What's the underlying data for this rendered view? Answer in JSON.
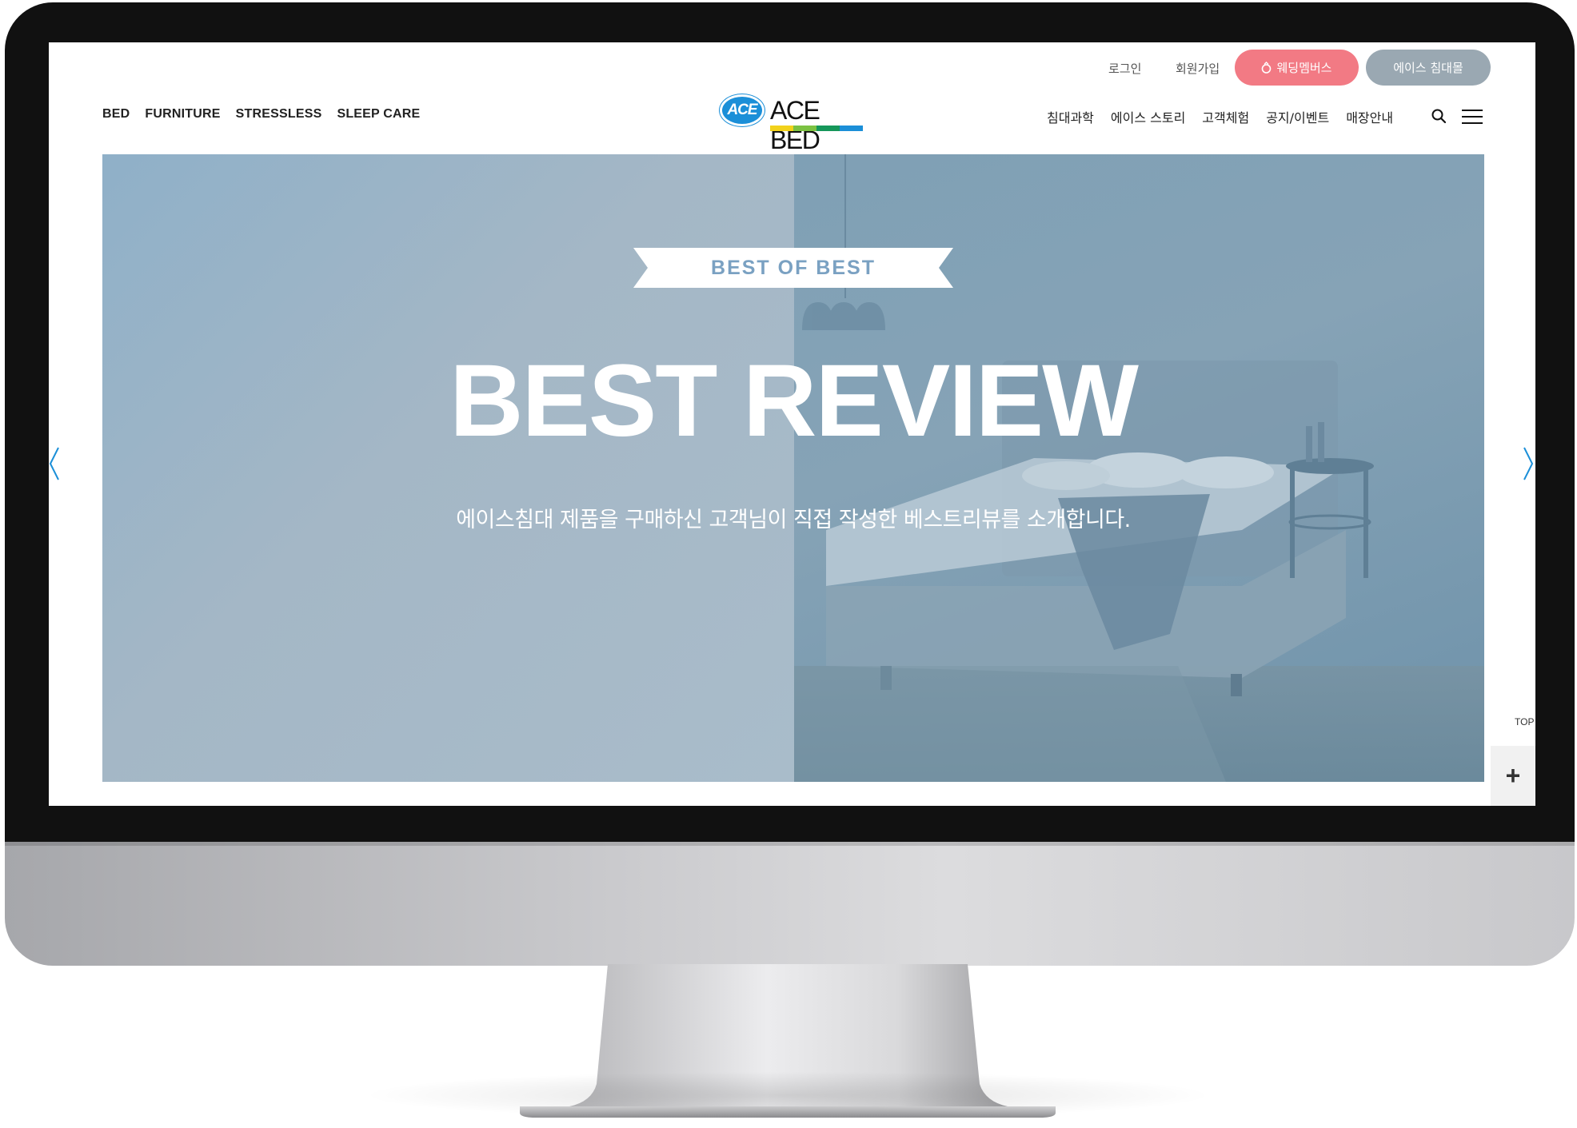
{
  "utility": {
    "login": "로그인",
    "signup": "회원가입",
    "wedding_members": "웨딩멤버스",
    "ace_mall": "에이스 침대몰"
  },
  "logo": {
    "badge": "ACE",
    "text": "ACE BED",
    "stripe_colors": [
      "#f2d21b",
      "#7cc242",
      "#16975a",
      "#1b8fd8"
    ]
  },
  "nav_left": [
    "BED",
    "FURNITURE",
    "STRESSLESS",
    "SLEEP CARE"
  ],
  "nav_right": [
    "침대과학",
    "에이스 스토리",
    "고객체험",
    "공지/이벤트",
    "매장안내"
  ],
  "hero": {
    "ribbon": "BEST OF BEST",
    "title": "BEST REVIEW",
    "subtitle": "에이스침대 제품을 구매하신 고객님이 직접 작성한 베스트리뷰를 소개합니다."
  },
  "side": {
    "top_label": "TOP",
    "plus": "+"
  },
  "colors": {
    "accent_pink": "#f27a84",
    "accent_gray": "#9aa8b2",
    "ribbon_text": "#7aa1c2",
    "arrow": "#1b8fd8"
  },
  "icons": [
    "search-icon",
    "menu-icon",
    "ring-icon",
    "chevron-left-icon",
    "chevron-right-icon"
  ]
}
